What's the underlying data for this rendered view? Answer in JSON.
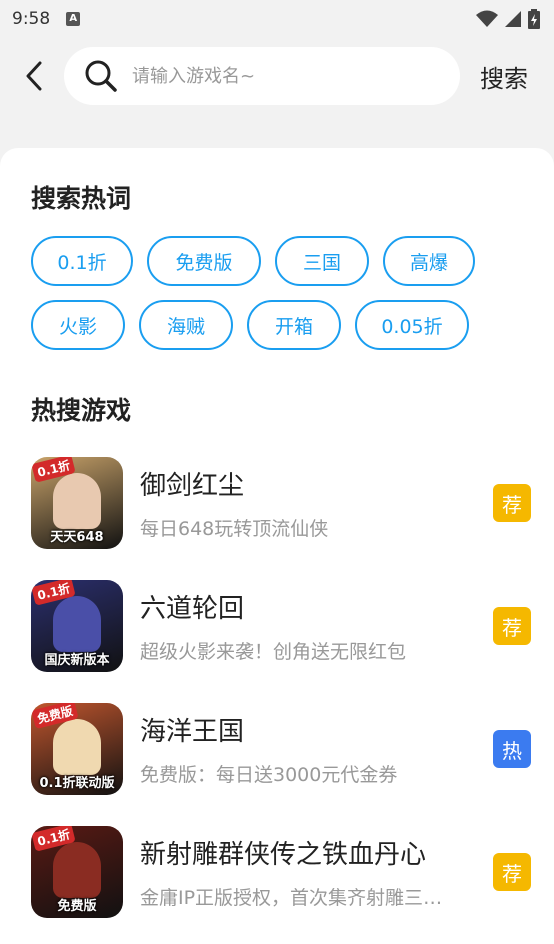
{
  "status_bar": {
    "time": "9:58",
    "notification_icon": "A"
  },
  "search": {
    "placeholder": "请输入游戏名~",
    "button_label": "搜索"
  },
  "hot_words": {
    "title": "搜索热词",
    "rows": [
      [
        "0.1折",
        "免费版",
        "三国",
        "高爆"
      ],
      [
        "火影",
        "海贼",
        "开箱",
        "0.05折"
      ]
    ]
  },
  "hot_games": {
    "title": "热搜游戏",
    "items": [
      {
        "name": "御剑红尘",
        "desc": "每日648玩转顶流仙侠",
        "badge": "荐",
        "badge_color": "#f5b800",
        "icon_badge": "0.1折",
        "icon_caption": "天天648",
        "icon_bg": "#c9a36a",
        "icon_figure": "#e8c9b0"
      },
      {
        "name": "六道轮回",
        "desc": "超级火影来袭！创角送无限红包",
        "badge": "荐",
        "badge_color": "#f5b800",
        "icon_badge": "0.1折",
        "icon_caption": "国庆新版本",
        "icon_bg": "#2b2f6e",
        "icon_figure": "#4a4fa8"
      },
      {
        "name": "海洋王国",
        "desc": "免费版：每日送3000元代金券",
        "badge": "热",
        "badge_color": "#3b7bf0",
        "icon_badge": "免费版",
        "icon_caption": "0.1折联动版",
        "icon_bg": "#c0562e",
        "icon_figure": "#f0d9b0"
      },
      {
        "name": "新射雕群侠传之铁血丹心",
        "desc": "金庸IP正版授权，首次集齐射雕三部曲",
        "badge": "荐",
        "badge_color": "#f5b800",
        "icon_badge": "0.1折",
        "icon_caption": "免费版",
        "icon_bg": "#5a1a14",
        "icon_figure": "#8a2c22"
      }
    ]
  }
}
